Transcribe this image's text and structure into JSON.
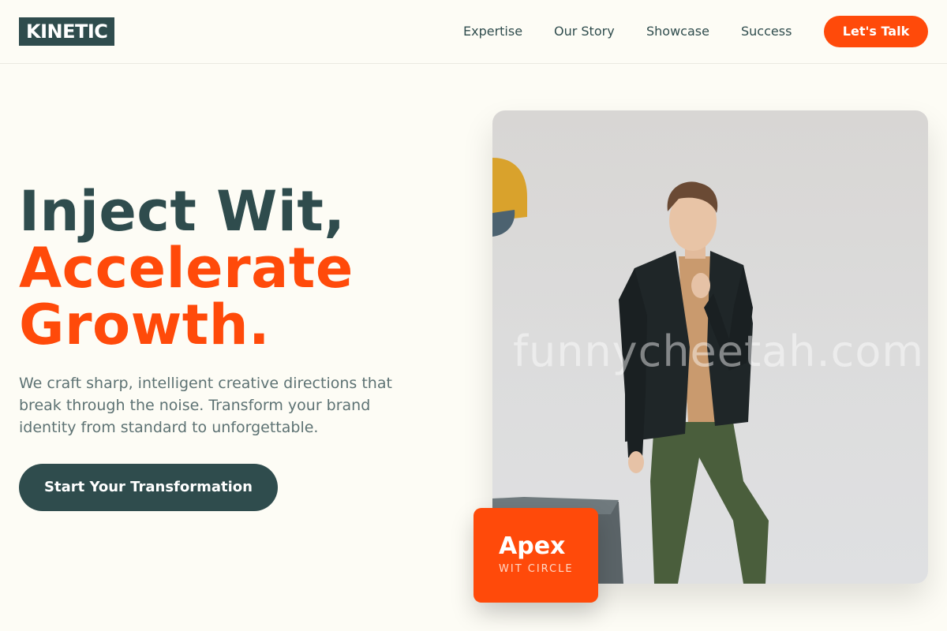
{
  "header": {
    "logo": "KINETIC",
    "nav": [
      {
        "label": "Expertise"
      },
      {
        "label": "Our Story"
      },
      {
        "label": "Showcase"
      },
      {
        "label": "Success"
      }
    ],
    "cta_label": "Let's Talk"
  },
  "hero": {
    "title_line1": "Inject Wit,",
    "title_line2": "Accelerate",
    "title_line3": "Growth.",
    "subtitle": "We craft sharp, intelligent creative directions that break through the noise. Transform your brand identity from standard to unforgettable.",
    "button_label": "Start Your Transformation"
  },
  "photo": {
    "watermark": "funnycheetah.com"
  },
  "badge": {
    "title": "Apex",
    "subtitle": "WIT CIRCLE"
  },
  "colors": {
    "background": "#fdfcf5",
    "primary_dark": "#2f4c4d",
    "accent": "#ff4a0a",
    "muted_text": "#5d7273"
  }
}
